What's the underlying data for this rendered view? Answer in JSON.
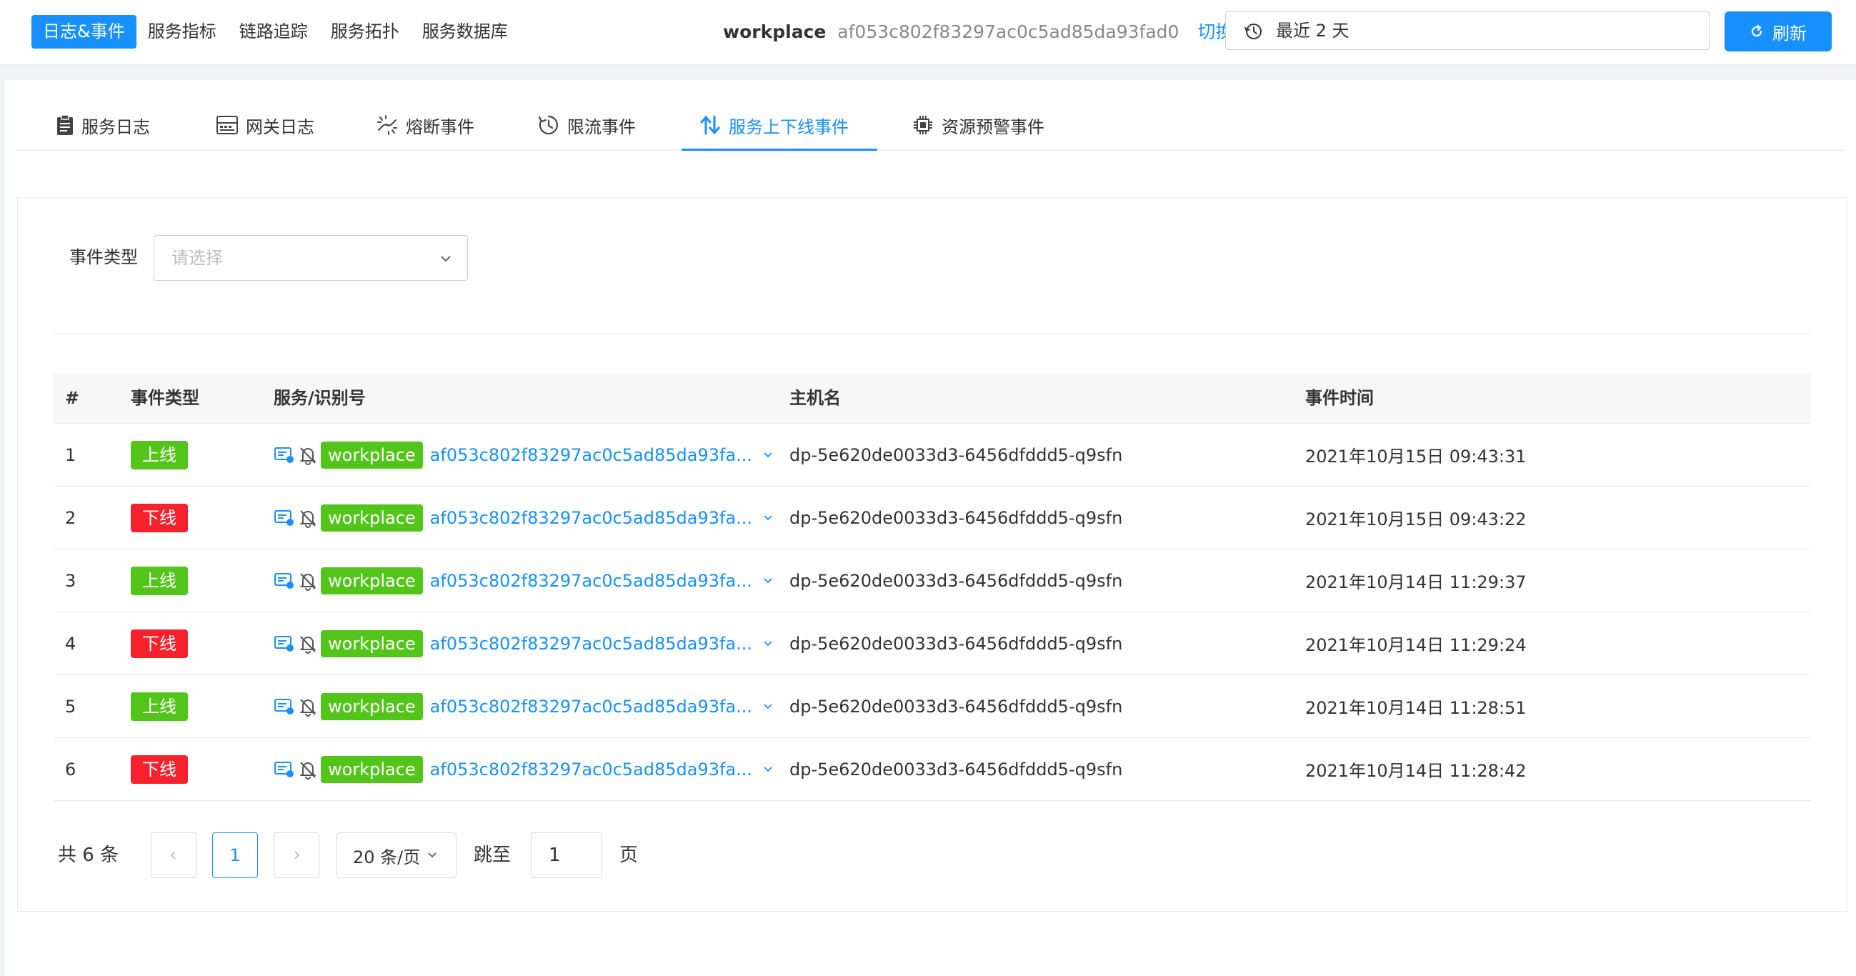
{
  "top_nav": {
    "items": [
      {
        "label": "日志&事件",
        "active": true
      },
      {
        "label": "服务指标",
        "active": false
      },
      {
        "label": "链路追踪",
        "active": false
      },
      {
        "label": "服务拓扑",
        "active": false
      },
      {
        "label": "服务数据库",
        "active": false
      }
    ]
  },
  "service": {
    "name": "workplace",
    "id": "af053c802f83297ac0c5ad85da93fad0",
    "switch_label": "切换"
  },
  "time_range": {
    "label": "最近 2 天",
    "icon": "history-clock-icon"
  },
  "refresh": {
    "label": "刷新",
    "icon": "refresh-icon"
  },
  "tabs": [
    {
      "label": "服务日志",
      "icon": "clipboard-icon",
      "active": false
    },
    {
      "label": "网关日志",
      "icon": "gateway-icon",
      "active": false
    },
    {
      "label": "熔断事件",
      "icon": "broken-link-icon",
      "active": false
    },
    {
      "label": "限流事件",
      "icon": "timer-icon",
      "active": false
    },
    {
      "label": "服务上下线事件",
      "icon": "up-down-arrows-icon",
      "active": true
    },
    {
      "label": "资源预警事件",
      "icon": "chip-icon",
      "active": false
    }
  ],
  "filter": {
    "label": "事件类型",
    "placeholder": "请选择"
  },
  "table": {
    "headers": [
      "#",
      "事件类型",
      "服务/识别号",
      "主机名",
      "事件时间"
    ],
    "rows": [
      {
        "index": "1",
        "type": "上线",
        "kind": "up",
        "service": "workplace",
        "instance": "af053c802f83297ac0c5ad85da93fa...",
        "host": "dp-5e620de0033d3-6456dfddd5-q9sfn",
        "time": "2021年10月15日 09:43:31"
      },
      {
        "index": "2",
        "type": "下线",
        "kind": "down",
        "service": "workplace",
        "instance": "af053c802f83297ac0c5ad85da93fa...",
        "host": "dp-5e620de0033d3-6456dfddd5-q9sfn",
        "time": "2021年10月15日 09:43:22"
      },
      {
        "index": "3",
        "type": "上线",
        "kind": "up",
        "service": "workplace",
        "instance": "af053c802f83297ac0c5ad85da93fa...",
        "host": "dp-5e620de0033d3-6456dfddd5-q9sfn",
        "time": "2021年10月14日 11:29:37"
      },
      {
        "index": "4",
        "type": "下线",
        "kind": "down",
        "service": "workplace",
        "instance": "af053c802f83297ac0c5ad85da93fa...",
        "host": "dp-5e620de0033d3-6456dfddd5-q9sfn",
        "time": "2021年10月14日 11:29:24"
      },
      {
        "index": "5",
        "type": "上线",
        "kind": "up",
        "service": "workplace",
        "instance": "af053c802f83297ac0c5ad85da93fa...",
        "host": "dp-5e620de0033d3-6456dfddd5-q9sfn",
        "time": "2021年10月14日 11:28:51"
      },
      {
        "index": "6",
        "type": "下线",
        "kind": "down",
        "service": "workplace",
        "instance": "af053c802f83297ac0c5ad85da93fa...",
        "host": "dp-5e620de0033d3-6456dfddd5-q9sfn",
        "time": "2021年10月14日 11:28:42"
      }
    ]
  },
  "pagination": {
    "total_text": "共 6 条",
    "current_page": "1",
    "page_size": "20 条/页",
    "jump_label": "跳至",
    "jump_value": "1",
    "page_unit": "页"
  },
  "colors": {
    "accent": "#1890ff",
    "online": "#52c41a",
    "offline": "#f5222d"
  }
}
